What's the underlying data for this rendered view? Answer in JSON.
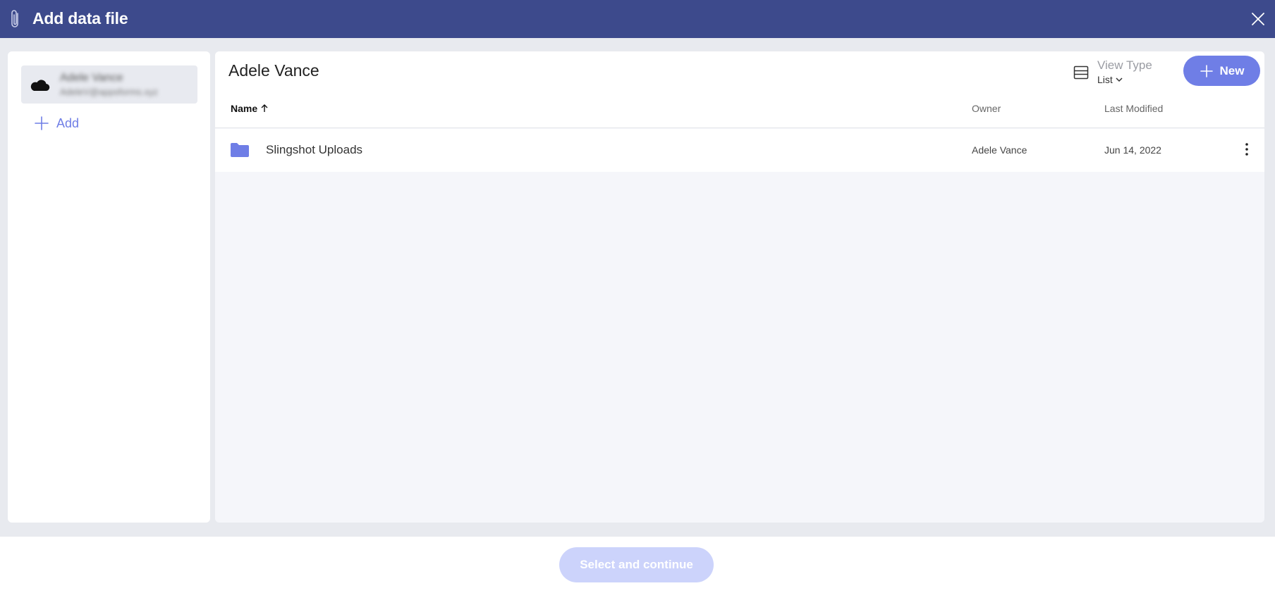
{
  "dialog": {
    "title": "Add data file",
    "icons": {
      "title": "paperclip-icon",
      "close": "close-icon"
    }
  },
  "sidebar": {
    "account": {
      "name": "Adele Vance",
      "email": "AdeleV@appsforms.xyz",
      "icon": "cloud-icon"
    },
    "add_label": "Add"
  },
  "main": {
    "folder_title": "Adele Vance",
    "view_type": {
      "label": "View Type",
      "value": "List"
    },
    "new_label": "New",
    "columns": {
      "name": "Name",
      "owner": "Owner",
      "last_modified": "Last Modified"
    },
    "rows": [
      {
        "name": "Slingshot Uploads",
        "owner": "Adele Vance",
        "last_modified": "Jun 14, 2022",
        "icon": "folder-icon"
      }
    ]
  },
  "footer": {
    "continue_label": "Select and continue"
  },
  "colors": {
    "header": "#3d4a8c",
    "accent": "#6f7ee6",
    "disabled_button": "#ccd3fb",
    "background": "#e8eaef"
  }
}
